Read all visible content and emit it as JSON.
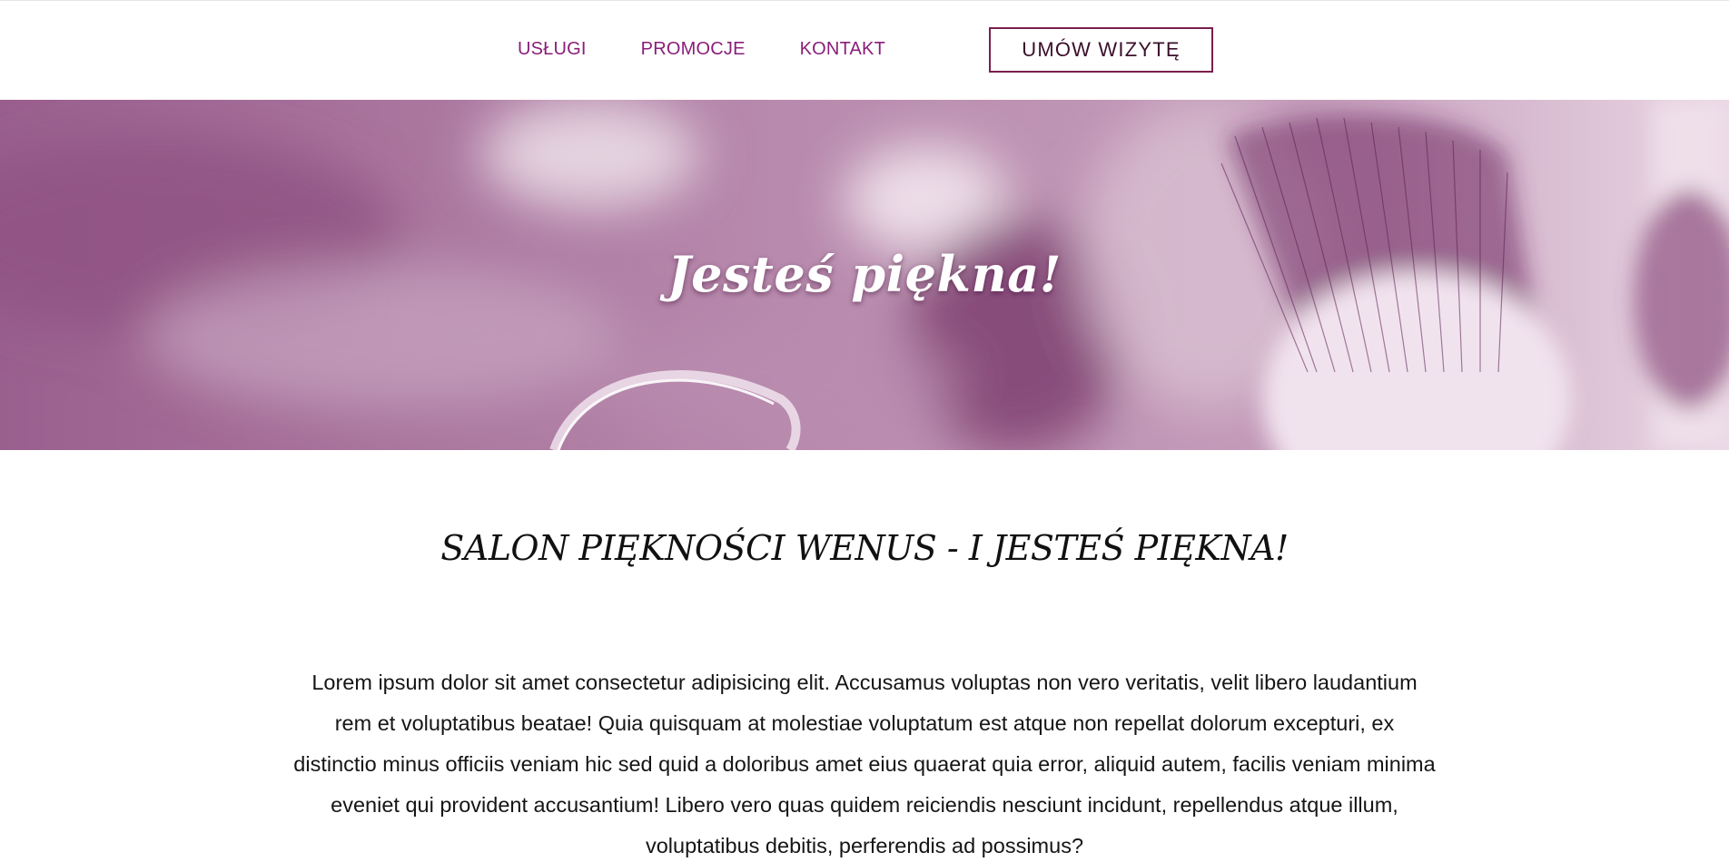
{
  "nav": {
    "items": [
      "USŁUGI",
      "PROMOCJE",
      "KONTAKT"
    ],
    "cta_label": "UMÓW WIZYTĘ"
  },
  "hero": {
    "title": "Jesteś piękna!"
  },
  "content": {
    "heading": "SALON PIĘKNOŚCI WENUS - I JESTEŚ PIĘKNA!",
    "paragraph": "Lorem ipsum dolor sit amet consectetur adipisicing elit. Accusamus voluptas non vero veritatis, velit libero laudantium rem et voluptatibus beatae! Quia quisquam at molestiae voluptatum est atque non repellat dolorum excepturi, ex distinctio minus officiis veniam hic sed quid a doloribus amet eius quaerat quia error, aliquid autem, facilis veniam minima eveniet qui provident accusantium! Libero vero quas quidem reiciendis nesciunt incidunt, repellendus atque illum, voluptatibus debitis, perferendis ad possimus?"
  },
  "colors": {
    "accent": "#8a1e79",
    "button_border": "#7a1e4e",
    "hero_tint": "#a06a95"
  }
}
